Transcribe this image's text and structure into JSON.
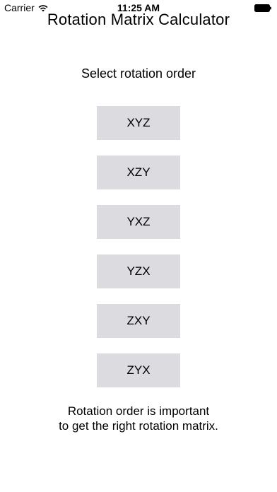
{
  "status_bar": {
    "carrier": "Carrier",
    "time": "11:25 AM",
    "wifi_icon": "wifi-icon",
    "battery_icon": "battery-icon"
  },
  "app": {
    "title": "Rotation Matrix Calculator"
  },
  "main": {
    "prompt": "Select rotation order",
    "orders": [
      {
        "label": "XYZ"
      },
      {
        "label": "XZY"
      },
      {
        "label": "YXZ"
      },
      {
        "label": "YZX"
      },
      {
        "label": "ZXY"
      },
      {
        "label": "ZYX"
      }
    ],
    "footnote_line1": "Rotation order is important",
    "footnote_line2": "to get the right rotation matrix."
  },
  "colors": {
    "button_background": "#dcdce0",
    "text": "#000000",
    "background": "#ffffff"
  }
}
